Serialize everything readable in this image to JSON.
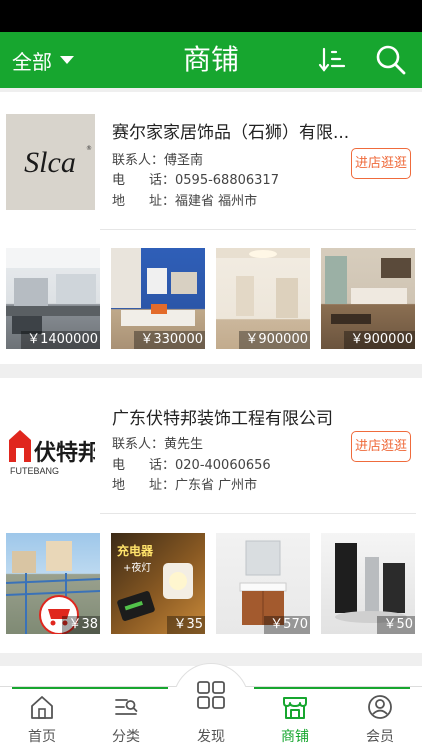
{
  "topbar": {
    "filter_label": "全部",
    "title": "商铺",
    "sort_icon": "sort-icon",
    "search_icon": "search-icon"
  },
  "shops": [
    {
      "name": "赛尔家家居饰品（石狮）有限...",
      "logo_text": "Slca",
      "contact_label": "联系人：",
      "contact": "傅圣南",
      "phone_label_a": "电",
      "phone_label_b": "话：",
      "phone": "0595-68806317",
      "addr_label_a": "地",
      "addr_label_b": "址：",
      "address": "福建省 福州市",
      "visit_label": "进店逛逛",
      "products": [
        {
          "price": "￥1400000"
        },
        {
          "price": "￥330000"
        },
        {
          "price": "￥900000"
        },
        {
          "price": "￥900000"
        }
      ]
    },
    {
      "name": "广东伏特邦装饰工程有限公司",
      "logo_text": "伏特邦",
      "logo_subtext": "FUTEBANG",
      "contact_label": "联系人：",
      "contact": "黄先生",
      "phone_label_a": "电",
      "phone_label_b": "话：",
      "phone": "020-40060656",
      "addr_label_a": "地",
      "addr_label_b": "址：",
      "address": "广东省 广州市",
      "visit_label": "进店逛逛",
      "products": [
        {
          "price": "￥38"
        },
        {
          "price": "￥35"
        },
        {
          "price": "￥570"
        },
        {
          "price": "￥50"
        }
      ]
    }
  ],
  "bottom_nav": [
    {
      "label": "首页",
      "icon": "home-icon"
    },
    {
      "label": "分类",
      "icon": "category-icon"
    },
    {
      "label": "发现",
      "icon": "discover-grid-icon"
    },
    {
      "label": "商铺",
      "icon": "shop-icon",
      "active": true
    },
    {
      "label": "会员",
      "icon": "member-icon"
    }
  ],
  "colors": {
    "brand": "#17a62f",
    "accent": "#ef6b3c"
  }
}
